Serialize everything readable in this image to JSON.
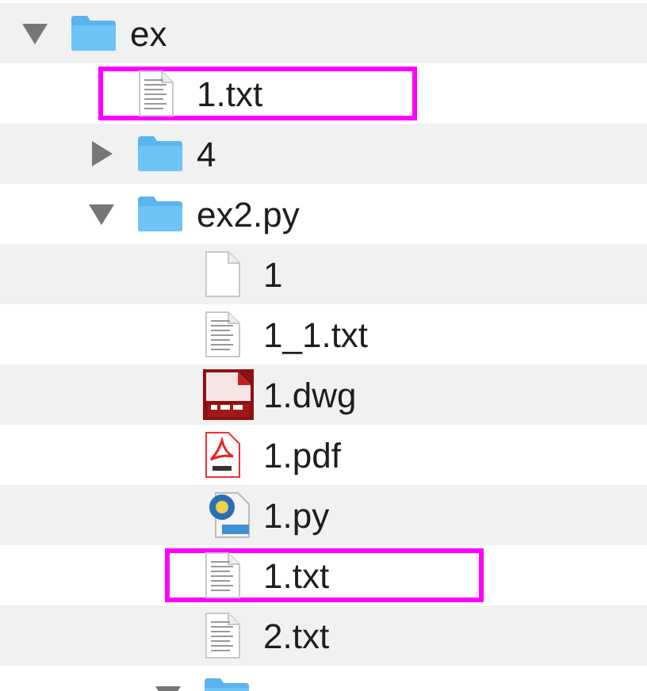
{
  "tree": [
    {
      "kind": "folder",
      "name": "ex",
      "expanded": true,
      "highlighted": false,
      "children": [
        {
          "kind": "text",
          "name": "1.txt",
          "highlighted": true
        },
        {
          "kind": "folder",
          "name": "4",
          "expanded": false,
          "highlighted": false
        },
        {
          "kind": "folder",
          "name": "ex2.py",
          "expanded": true,
          "highlighted": false,
          "children": [
            {
              "kind": "blank",
              "name": "1",
              "highlighted": false
            },
            {
              "kind": "text",
              "name": "1_1.txt",
              "highlighted": false
            },
            {
              "kind": "dwg",
              "name": "1.dwg",
              "highlighted": false
            },
            {
              "kind": "pdf",
              "name": "1.pdf",
              "highlighted": false
            },
            {
              "kind": "python",
              "name": "1.py",
              "highlighted": false
            },
            {
              "kind": "text",
              "name": "1.txt",
              "highlighted": true
            },
            {
              "kind": "text",
              "name": "2.txt",
              "highlighted": false
            },
            {
              "kind": "folder",
              "expanded": true,
              "highlighted": false
            }
          ]
        }
      ]
    }
  ]
}
